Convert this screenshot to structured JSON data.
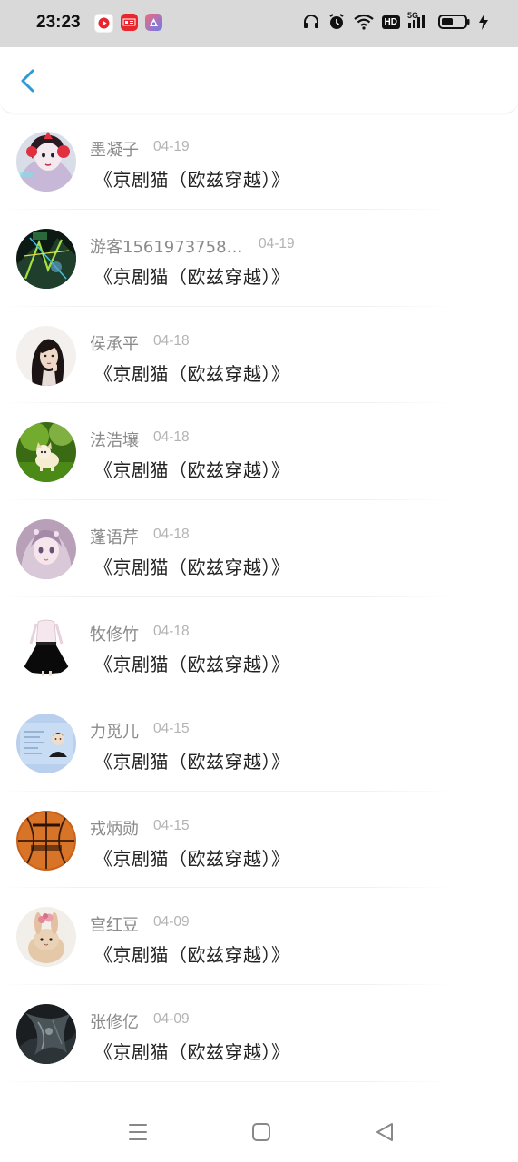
{
  "status_bar": {
    "time": "23:23",
    "app_icons": [
      "record-app-icon",
      "news-app-icon",
      "launcher-app-icon"
    ],
    "indicators": [
      "headphones-icon",
      "alarm-icon",
      "wifi-icon",
      "hd-icon",
      "5g-signal-icon",
      "battery-icon",
      "charging-icon"
    ],
    "hd_label": "HD",
    "network_label": "5G"
  },
  "header": {
    "back_icon": "chevron-left-icon",
    "accent": "#2a9bd8"
  },
  "items": [
    {
      "name": "墨凝子",
      "date": "04-19",
      "title": "《京剧猫（欧兹穿越）》",
      "avatar": "avatar-girl-headphones"
    },
    {
      "name": "游客15619737583...",
      "date": "04-19",
      "title": "《京剧猫（欧兹穿越）》",
      "avatar": "avatar-dark-graphic"
    },
    {
      "name": "侯承平",
      "date": "04-18",
      "title": "《京剧猫（欧兹穿越）》",
      "avatar": "avatar-woman-portrait"
    },
    {
      "name": "法浩壤",
      "date": "04-18",
      "title": "《京剧猫（欧兹穿越）》",
      "avatar": "avatar-puppy-grass"
    },
    {
      "name": "蓬语芹",
      "date": "04-18",
      "title": "《京剧猫（欧兹穿越）》",
      "avatar": "avatar-anime-girl"
    },
    {
      "name": "牧修竹",
      "date": "04-18",
      "title": "《京剧猫（欧兹穿越）》",
      "avatar": "avatar-skirt-outfit"
    },
    {
      "name": "力觅儿",
      "date": "04-15",
      "title": "《京剧猫（欧兹穿越）》",
      "avatar": "avatar-id-card"
    },
    {
      "name": "戎炳勋",
      "date": "04-15",
      "title": "《京剧猫（欧兹穿越）》",
      "avatar": "avatar-basketball"
    },
    {
      "name": "宫红豆",
      "date": "04-09",
      "title": "《京剧猫（欧兹穿越）》",
      "avatar": "avatar-rabbit"
    },
    {
      "name": "张修亿",
      "date": "04-09",
      "title": "《京剧猫（欧兹穿越）》",
      "avatar": "avatar-dark-abstract"
    }
  ],
  "nav_bar": {
    "buttons": [
      "menu-icon",
      "home-icon",
      "back-triangle-icon"
    ]
  }
}
